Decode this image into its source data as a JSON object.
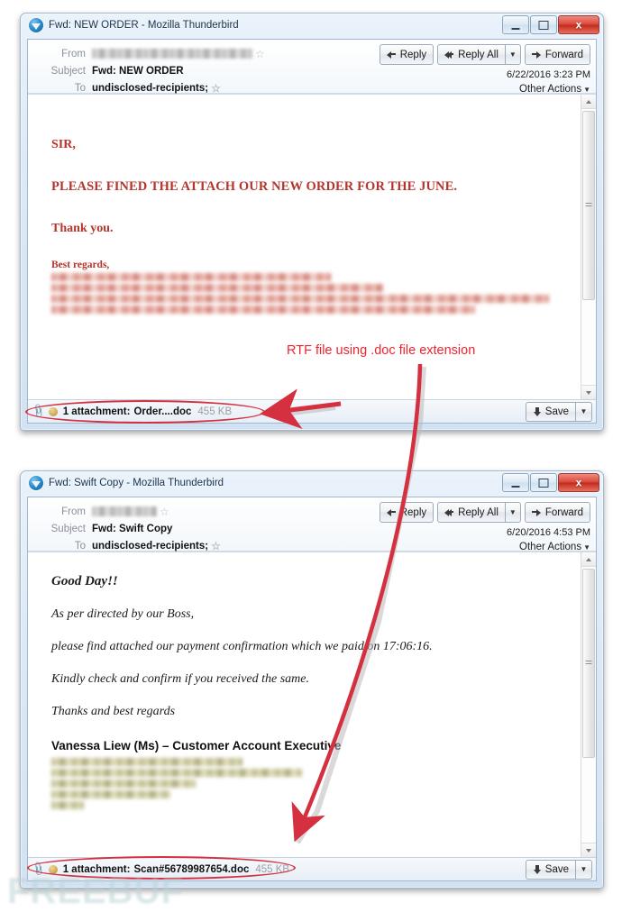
{
  "annotations": {
    "callout_text": "RTF file using .doc file extension"
  },
  "watermark": "FREEBUF",
  "windows": [
    {
      "id": "email-1",
      "title": "Fwd: NEW ORDER - Mozilla Thunderbird",
      "icon": "thunderbird-icon",
      "controls": {
        "minimize": "minimize-button",
        "maximize": "maximize-button",
        "close_label": "x"
      },
      "header": {
        "from_label": "From",
        "from_value": "",
        "subject_label": "Subject",
        "subject_value": "Fwd: NEW ORDER",
        "to_label": "To",
        "to_value": "undisclosed-recipients;",
        "date": "6/22/2016 3:23 PM",
        "other_actions": "Other Actions",
        "buttons": {
          "reply": "Reply",
          "reply_all": "Reply All",
          "forward": "Forward"
        }
      },
      "body": {
        "greeting": "SIR,",
        "line1": "PLEASE FINED THE ATTACH OUR NEW ORDER FOR  THE JUNE.",
        "thanks": "Thank you.",
        "signoff": "Best regards,"
      },
      "attachment": {
        "count_text": "1 attachment:",
        "filename": "Order....doc",
        "size": "455 KB",
        "save_label": "Save"
      }
    },
    {
      "id": "email-2",
      "title": "Fwd: Swift Copy - Mozilla Thunderbird",
      "icon": "thunderbird-icon",
      "controls": {
        "minimize": "minimize-button",
        "maximize": "maximize-button",
        "close_label": "x"
      },
      "header": {
        "from_label": "From",
        "from_value": "",
        "subject_label": "Subject",
        "subject_value": "Fwd: Swift Copy",
        "to_label": "To",
        "to_value": "undisclosed-recipients;",
        "date": "6/20/2016 4:53 PM",
        "other_actions": "Other Actions",
        "buttons": {
          "reply": "Reply",
          "reply_all": "Reply All",
          "forward": "Forward"
        }
      },
      "body": {
        "greeting": "Good Day!!",
        "line1": "As per directed by our Boss,",
        "line2": "please find attached our payment confirmation which we paid on 17:06:16.",
        "line3": "Kindly check and confirm if you received the same.",
        "line4": "Thanks and best regards",
        "signature": "Vanessa Liew (Ms) – Customer Account Executive"
      },
      "attachment": {
        "count_text": "1 attachment:",
        "filename": "Scan#56789987654.doc",
        "size": "455 KB",
        "save_label": "Save"
      }
    }
  ],
  "colors": {
    "annotation_red": "#f0222e",
    "ellipse_red": "#d4303f",
    "body_red": "#b5342c",
    "titlebar_blue": "#16314d"
  }
}
